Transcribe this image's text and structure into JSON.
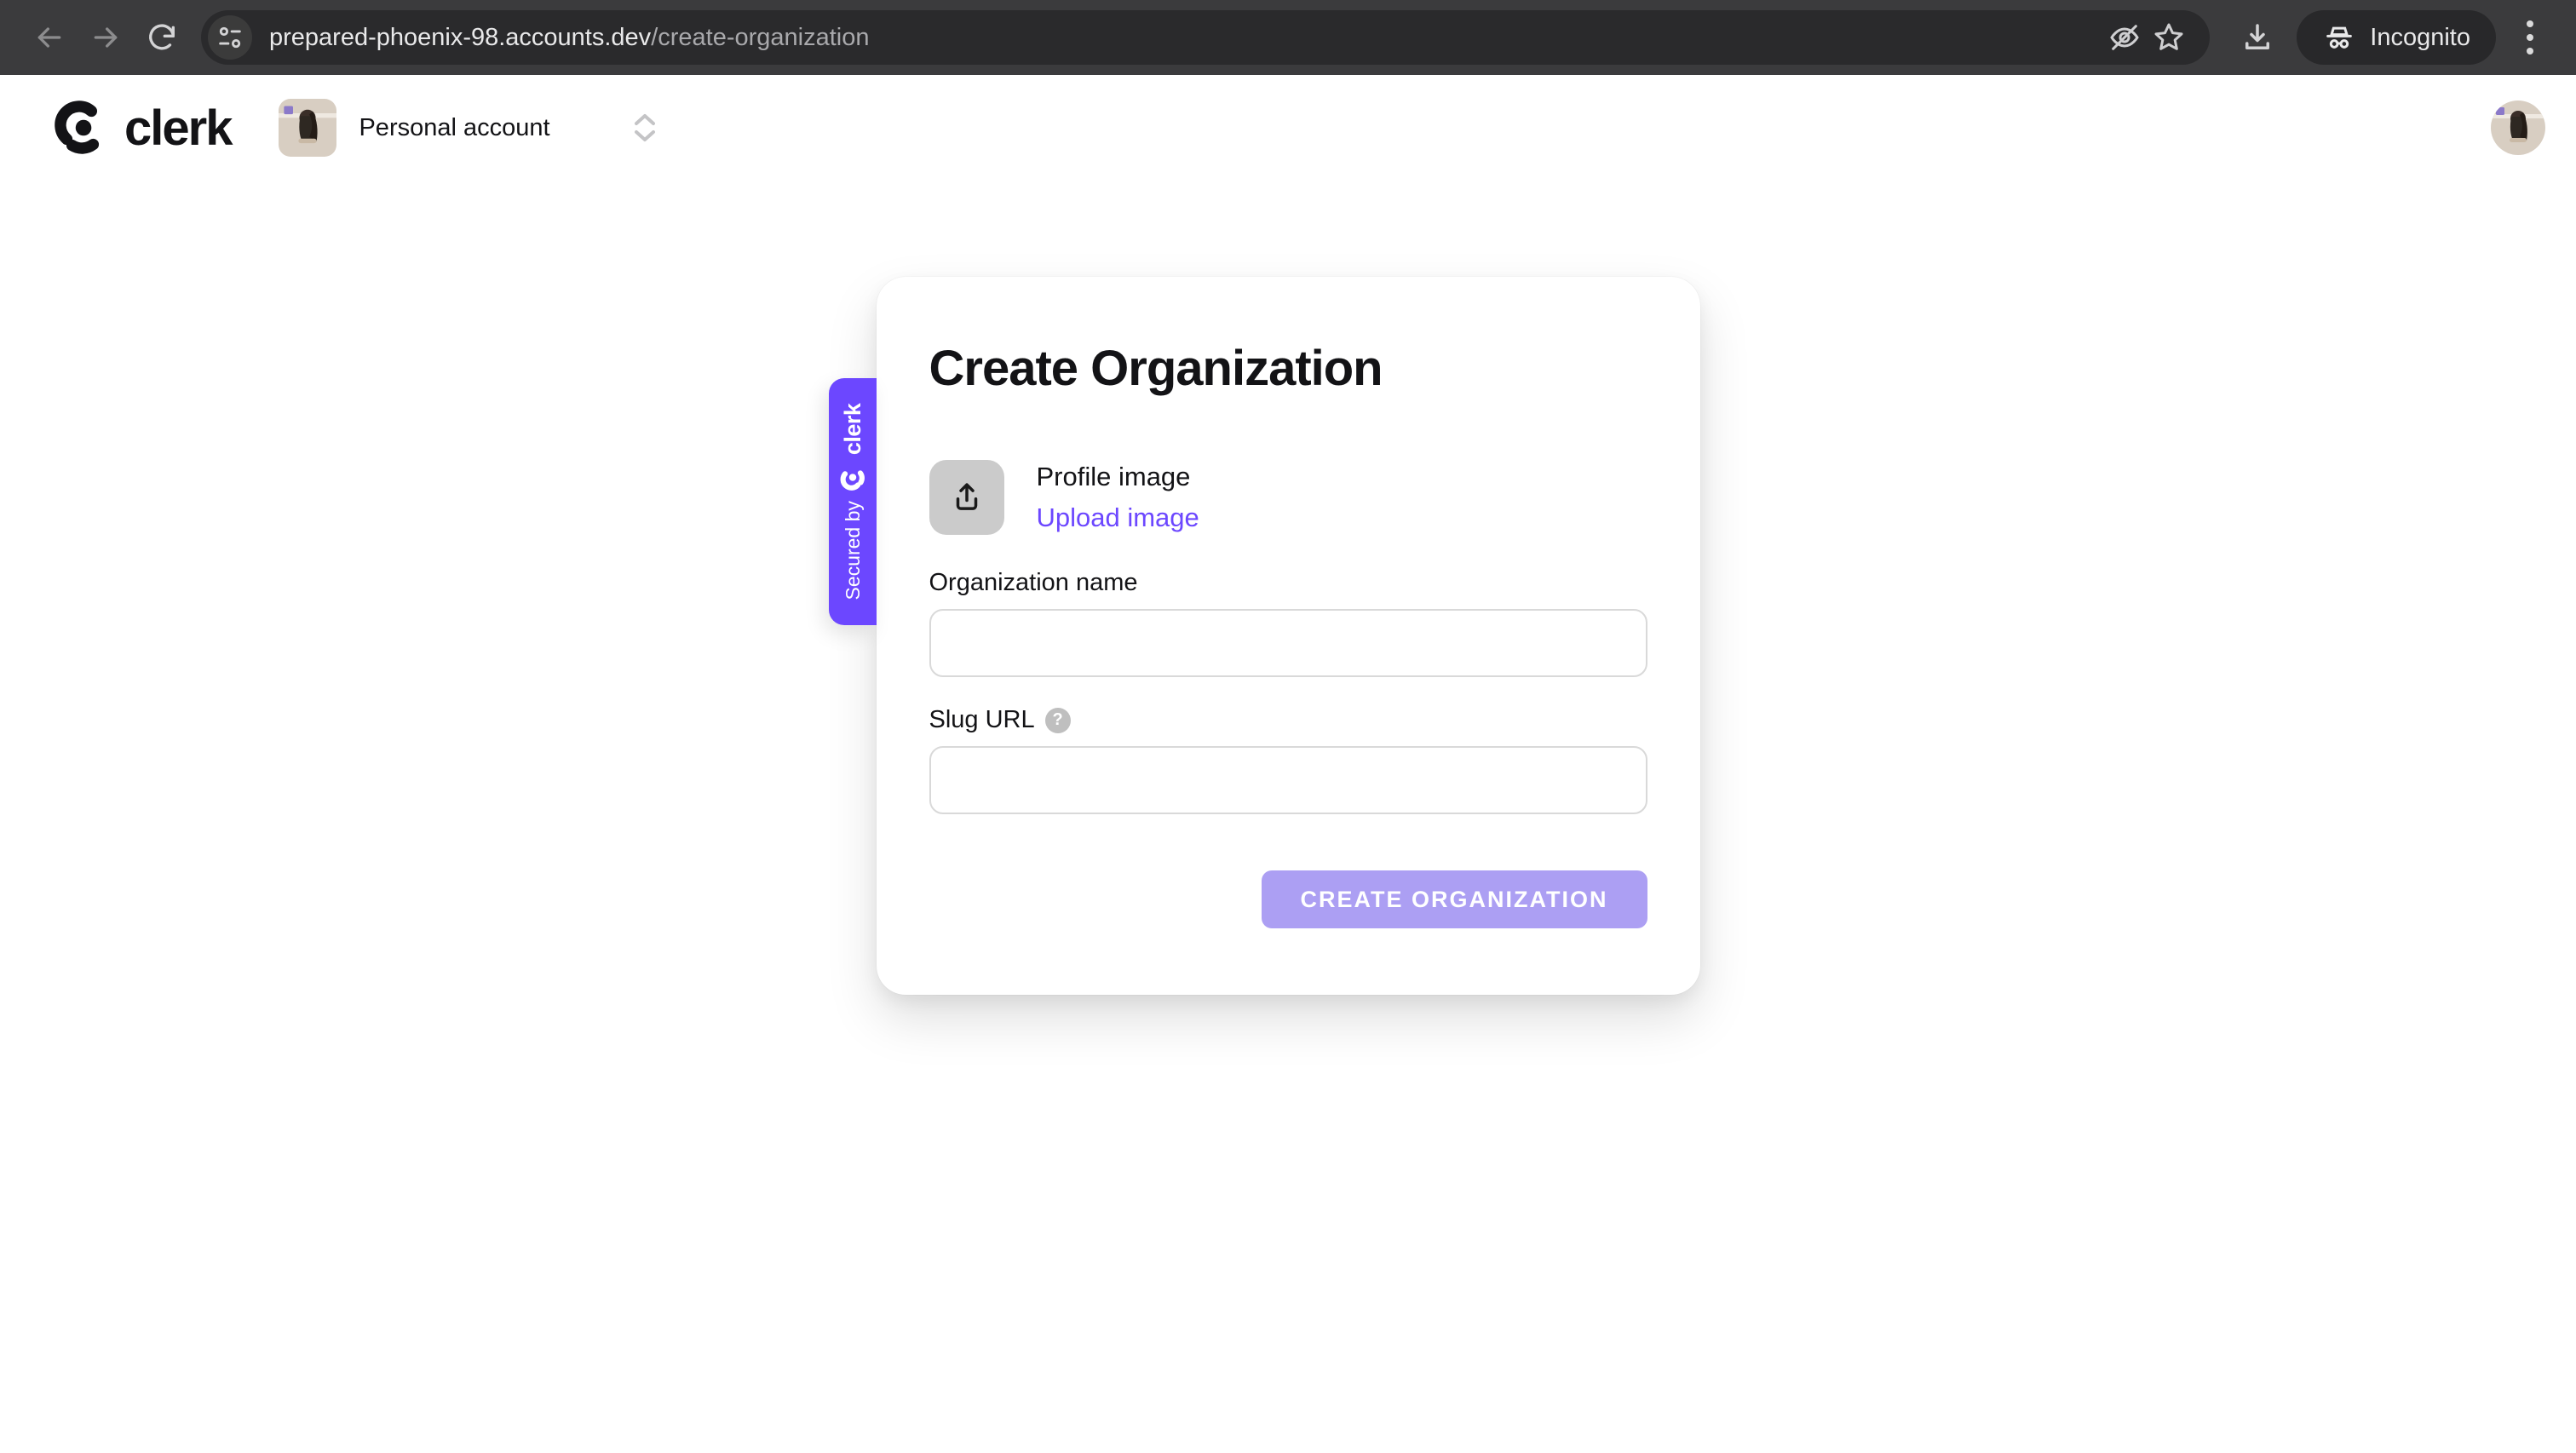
{
  "browser": {
    "url_domain": "prepared-phoenix-98.accounts.dev",
    "url_path": "/create-organization",
    "incognito_label": "Incognito"
  },
  "header": {
    "brand": "clerk",
    "account_switcher_label": "Personal account"
  },
  "card": {
    "title": "Create Organization",
    "profile_image_label": "Profile image",
    "upload_link_label": "Upload image",
    "org_name_label": "Organization name",
    "org_name_value": "",
    "slug_label": "Slug URL",
    "slug_value": "",
    "help_glyph": "?",
    "submit_label": "CREATE ORGANIZATION"
  },
  "secured_badge": {
    "prefix": "Secured by",
    "brand": "clerk"
  },
  "colors": {
    "accent": "#6C47FF",
    "button_disabled": "#AC9FF3",
    "toolbar_bg": "#3B3B3D",
    "omnibox_bg": "#2A2A2C"
  }
}
